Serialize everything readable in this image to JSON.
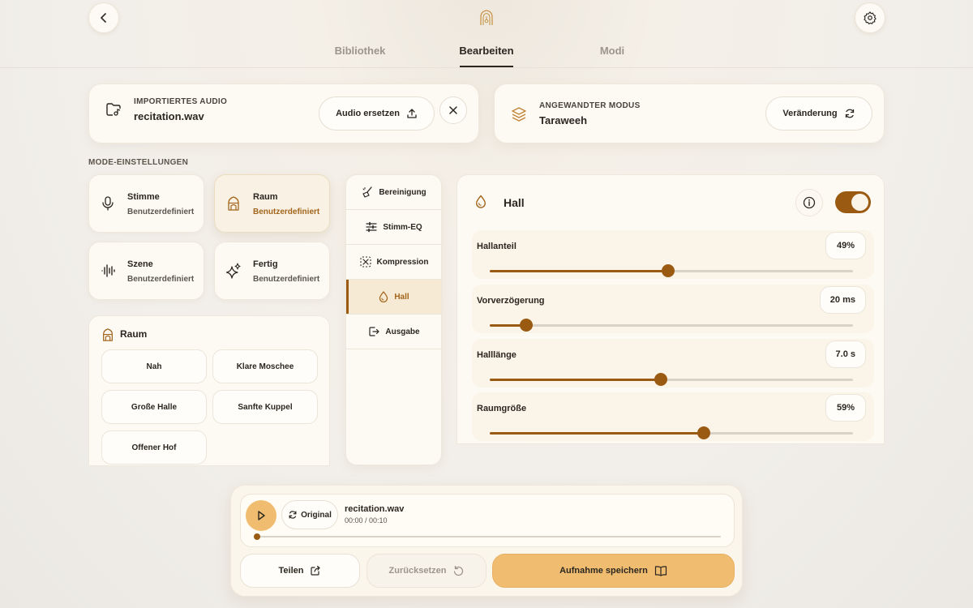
{
  "header": {
    "back_icon": "chevron-left-icon",
    "logo_icon": "arch-lantern-icon",
    "settings_icon": "gear-icon"
  },
  "tabs": [
    {
      "label": "Bibliothek",
      "active": false
    },
    {
      "label": "Bearbeiten",
      "active": true
    },
    {
      "label": "Modi",
      "active": false
    }
  ],
  "imported_audio": {
    "label": "IMPORTIERTES AUDIO",
    "filename": "recitation.wav",
    "replace_button": "Audio ersetzen",
    "icon": "folder-audio-icon"
  },
  "applied_mode": {
    "label": "ANGEWANDTER MODUS",
    "value": "Taraweeh",
    "change_button": "Veränderung",
    "icon": "layers-icon"
  },
  "mode_settings": {
    "section_label": "MODE-EINSTELLUNGEN",
    "tiles": [
      {
        "title": "Stimme",
        "subtitle": "Benutzerdefiniert",
        "icon": "microphone-icon",
        "active": false
      },
      {
        "title": "Raum",
        "subtitle": "Benutzerdefiniert",
        "icon": "mosque-icon",
        "active": true
      },
      {
        "title": "Szene",
        "subtitle": "Benutzerdefiniert",
        "icon": "waveform-icon",
        "active": false
      },
      {
        "title": "Fertig",
        "subtitle": "Benutzerdefiniert",
        "icon": "sparkles-icon",
        "active": false
      }
    ]
  },
  "room_panel": {
    "title": "Raum",
    "presets": [
      "Nah",
      "Klare Moschee",
      "Große Halle",
      "Sanfte Kuppel",
      "Offener Hof"
    ]
  },
  "sections": [
    {
      "label": "Bereinigung",
      "icon": "broom-icon",
      "active": false
    },
    {
      "label": "Stimm-EQ",
      "icon": "sliders-icon",
      "active": false
    },
    {
      "label": "Kompression",
      "icon": "compress-icon",
      "active": false
    },
    {
      "label": "Hall",
      "icon": "drop-icon",
      "active": true
    },
    {
      "label": "Ausgabe",
      "icon": "export-icon",
      "active": false
    }
  ],
  "hall": {
    "title": "Hall",
    "enabled": true,
    "params": [
      {
        "label": "Hallanteil",
        "value": "49%",
        "level": 0.49
      },
      {
        "label": "Vorverzögerung",
        "value": "20 ms",
        "level": 0.1
      },
      {
        "label": "Halllänge",
        "value": "7.0 s",
        "level": 0.47
      },
      {
        "label": "Raumgröße",
        "value": "59%",
        "level": 0.59
      }
    ]
  },
  "player": {
    "filename": "recitation.wav",
    "time": "00:00 / 00:10",
    "original_label": "Original",
    "progress": 0.0,
    "share_label": "Teilen",
    "reset_label": "Zurücksetzen",
    "save_label": "Aufnahme speichern"
  },
  "colors": {
    "accent": "#9a5a12",
    "accent_light": "#f0bd70",
    "active_sub": "#a2651b"
  }
}
